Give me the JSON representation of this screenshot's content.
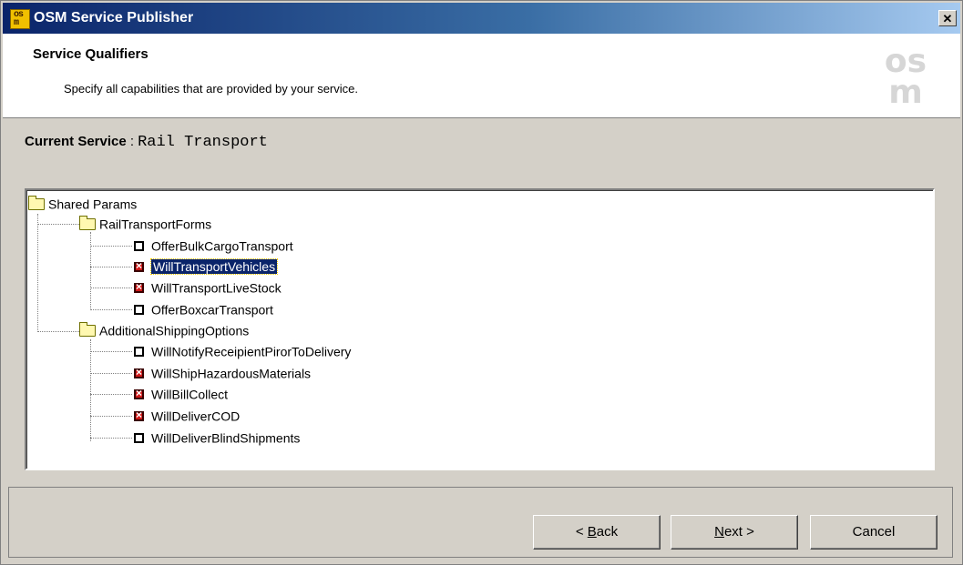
{
  "window": {
    "title": "OSM Service Publisher",
    "close": "✕"
  },
  "header": {
    "title": "Service Qualifiers",
    "subtitle": "Specify all capabilities that are provided by your service.",
    "logo_top": "os",
    "logo_bottom": "m"
  },
  "current_service": {
    "label": "Current Service",
    "separator": " :",
    "value": "Rail Transport"
  },
  "tree": {
    "root": "Shared Params",
    "groups": [
      {
        "label": "RailTransportForms",
        "items": [
          {
            "label": "OfferBulkCargoTransport",
            "checked": false
          },
          {
            "label": "WillTransportVehicles",
            "checked": true,
            "selected": true
          },
          {
            "label": "WillTransportLiveStock",
            "checked": true
          },
          {
            "label": "OfferBoxcarTransport",
            "checked": false
          }
        ]
      },
      {
        "label": "AdditionalShippingOptions",
        "items": [
          {
            "label": "WillNotifyReceipientPirorToDelivery",
            "checked": false
          },
          {
            "label": "WillShipHazardousMaterials",
            "checked": true
          },
          {
            "label": "WillBillCollect",
            "checked": true
          },
          {
            "label": "WillDeliverCOD",
            "checked": true
          },
          {
            "label": "WillDeliverBlindShipments",
            "checked": false
          }
        ]
      }
    ]
  },
  "buttons": {
    "back_prefix": "< ",
    "back_key": "B",
    "back_rest": "ack",
    "next_key": "N",
    "next_rest": "ext >",
    "cancel": "Cancel"
  }
}
